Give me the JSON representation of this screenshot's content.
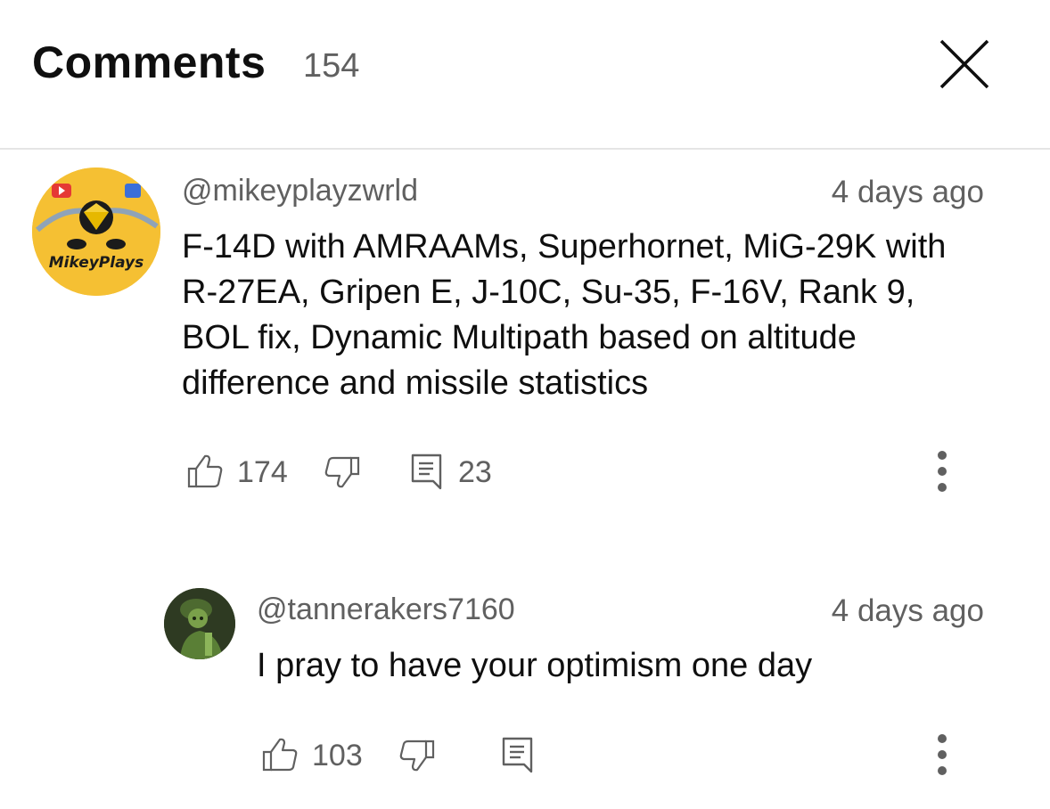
{
  "header": {
    "title": "Comments",
    "count": "154"
  },
  "comments": [
    {
      "handle": "@mikeyplayzwrld",
      "timestamp": "4 days ago",
      "avatar_logo_text": "MikeyPlays",
      "text": "F-14D with AMRAAMs, Superhornet, MiG-29K with R-27EA, Gripen E, J-10C, Su-35, F-16V, Rank 9, BOL fix, Dynamic Multipath based on altitude difference and missile statistics",
      "likes": "174",
      "replies": "23"
    },
    {
      "handle": "@tannerakers7160",
      "timestamp": "4 days ago",
      "text": "I pray to have your optimism one day",
      "likes": "103"
    }
  ],
  "icons": {
    "close": "close-icon",
    "like": "thumbs-up-icon",
    "dislike": "thumbs-down-icon",
    "reply": "reply-icon",
    "more": "more-vert-icon"
  },
  "colors": {
    "primary_text": "#0f0f0f",
    "secondary_text": "#606060",
    "divider": "#e5e5e5",
    "avatar1_bg": "#f5c033"
  }
}
